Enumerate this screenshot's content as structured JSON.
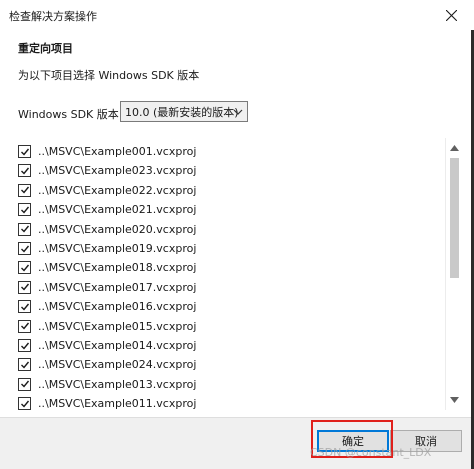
{
  "window": {
    "title": "检查解决方案操作"
  },
  "section_title": "重定向项目",
  "instruction": "为以下项目选择 Windows SDK 版本",
  "sdk": {
    "label": "Windows SDK 版本:",
    "selected": "10.0 (最新安装的版本)"
  },
  "projects": [
    {
      "label": "..\\MSVC\\Example001.vcxproj",
      "checked": true
    },
    {
      "label": "..\\MSVC\\Example023.vcxproj",
      "checked": true
    },
    {
      "label": "..\\MSVC\\Example022.vcxproj",
      "checked": true
    },
    {
      "label": "..\\MSVC\\Example021.vcxproj",
      "checked": true
    },
    {
      "label": "..\\MSVC\\Example020.vcxproj",
      "checked": true
    },
    {
      "label": "..\\MSVC\\Example019.vcxproj",
      "checked": true
    },
    {
      "label": "..\\MSVC\\Example018.vcxproj",
      "checked": true
    },
    {
      "label": "..\\MSVC\\Example017.vcxproj",
      "checked": true
    },
    {
      "label": "..\\MSVC\\Example016.vcxproj",
      "checked": true
    },
    {
      "label": "..\\MSVC\\Example015.vcxproj",
      "checked": true
    },
    {
      "label": "..\\MSVC\\Example014.vcxproj",
      "checked": true
    },
    {
      "label": "..\\MSVC\\Example024.vcxproj",
      "checked": true
    },
    {
      "label": "..\\MSVC\\Example013.vcxproj",
      "checked": true
    },
    {
      "label": "..\\MSVC\\Example011.vcxproj",
      "checked": true
    }
  ],
  "footer": {
    "ok_label": "确定",
    "cancel_label": "取消"
  },
  "watermark": "CSDN @constant_LDX",
  "colors": {
    "highlight": "#e0201b",
    "focus": "#0078d7"
  }
}
